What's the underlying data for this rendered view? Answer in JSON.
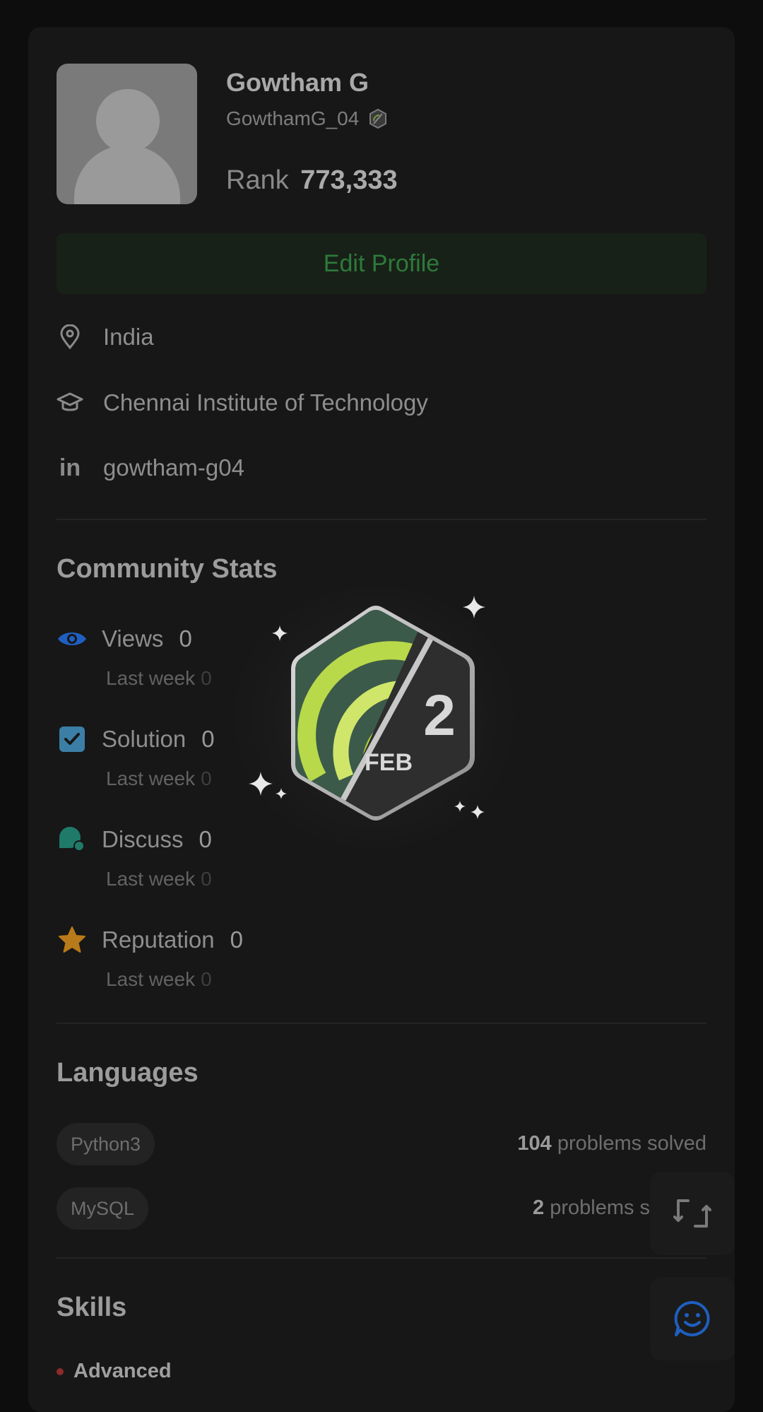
{
  "profile": {
    "name": "Gowtham G",
    "username": "GowthamG_04",
    "rank_label": "Rank",
    "rank_value": "773,333",
    "edit_button": "Edit Profile",
    "location": "India",
    "institution": "Chennai Institute of Technology",
    "linkedin": "gowtham-g04",
    "linkedin_icon_text": "in"
  },
  "community_stats": {
    "title": "Community Stats",
    "last_week_label": "Last week",
    "items": [
      {
        "label": "Views",
        "value": "0",
        "last_week": "0",
        "icon": "eye-icon",
        "color": "#1f5fbf"
      },
      {
        "label": "Solution",
        "value": "0",
        "last_week": "0",
        "icon": "check-square-icon",
        "color": "#3b7fa6"
      },
      {
        "label": "Discuss",
        "value": "0",
        "last_week": "0",
        "icon": "chat-bubbles-icon",
        "color": "#1f7a6a"
      },
      {
        "label": "Reputation",
        "value": "0",
        "last_week": "0",
        "icon": "star-icon",
        "color": "#b87a1a"
      }
    ]
  },
  "badge": {
    "day": "2",
    "month": "FEB"
  },
  "languages": {
    "title": "Languages",
    "items": [
      {
        "name": "Python3",
        "count": "104",
        "suffix": "problems solved"
      },
      {
        "name": "MySQL",
        "count": "2",
        "suffix": "problems s"
      }
    ]
  },
  "skills": {
    "title": "Skills",
    "first_level": "Advanced"
  },
  "colors": {
    "accent_green": "#2d7a3a",
    "background": "#171717"
  }
}
